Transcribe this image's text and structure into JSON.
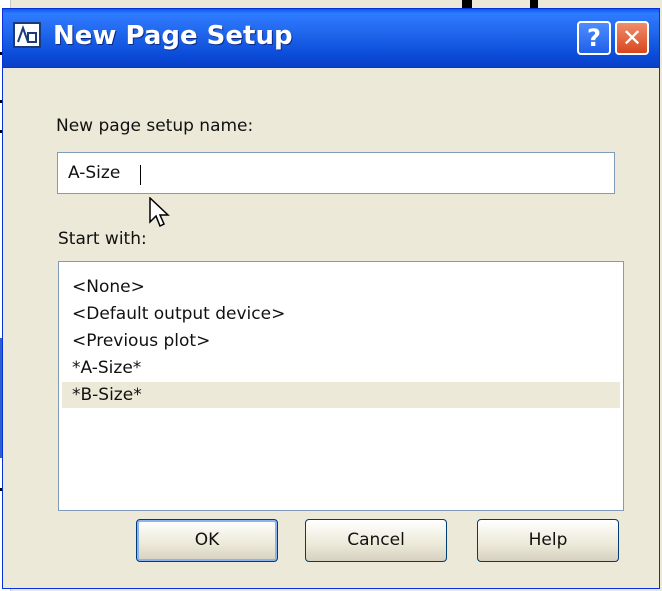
{
  "window": {
    "title": "New Page Setup",
    "help_label": "?",
    "close_label": "✕"
  },
  "form": {
    "name_label": "New page setup name:",
    "name_value": "A-Size",
    "start_label": "Start with:"
  },
  "start_with_list": {
    "items": [
      {
        "label": "<None>",
        "selected": false
      },
      {
        "label": "<Default output device>",
        "selected": false
      },
      {
        "label": "<Previous plot>",
        "selected": false
      },
      {
        "label": "*A-Size*",
        "selected": false
      },
      {
        "label": "*B-Size*",
        "selected": true
      }
    ]
  },
  "buttons": {
    "ok": "OK",
    "cancel": "Cancel",
    "help": "Help"
  },
  "colors": {
    "titlebar": "#1e64ea",
    "dialog_bg": "#ece9d8",
    "selection": "#ece9d8"
  }
}
